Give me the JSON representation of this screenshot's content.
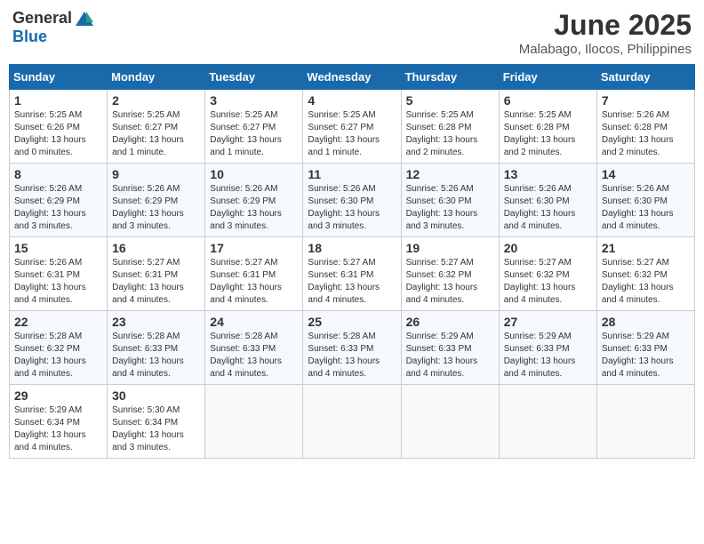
{
  "header": {
    "logo_general": "General",
    "logo_blue": "Blue",
    "month_title": "June 2025",
    "location": "Malabago, Ilocos, Philippines"
  },
  "weekdays": [
    "Sunday",
    "Monday",
    "Tuesday",
    "Wednesday",
    "Thursday",
    "Friday",
    "Saturday"
  ],
  "weeks": [
    [
      {
        "day": "1",
        "info": "Sunrise: 5:25 AM\nSunset: 6:26 PM\nDaylight: 13 hours\nand 0 minutes."
      },
      {
        "day": "2",
        "info": "Sunrise: 5:25 AM\nSunset: 6:27 PM\nDaylight: 13 hours\nand 1 minute."
      },
      {
        "day": "3",
        "info": "Sunrise: 5:25 AM\nSunset: 6:27 PM\nDaylight: 13 hours\nand 1 minute."
      },
      {
        "day": "4",
        "info": "Sunrise: 5:25 AM\nSunset: 6:27 PM\nDaylight: 13 hours\nand 1 minute."
      },
      {
        "day": "5",
        "info": "Sunrise: 5:25 AM\nSunset: 6:28 PM\nDaylight: 13 hours\nand 2 minutes."
      },
      {
        "day": "6",
        "info": "Sunrise: 5:25 AM\nSunset: 6:28 PM\nDaylight: 13 hours\nand 2 minutes."
      },
      {
        "day": "7",
        "info": "Sunrise: 5:26 AM\nSunset: 6:28 PM\nDaylight: 13 hours\nand 2 minutes."
      }
    ],
    [
      {
        "day": "8",
        "info": "Sunrise: 5:26 AM\nSunset: 6:29 PM\nDaylight: 13 hours\nand 3 minutes."
      },
      {
        "day": "9",
        "info": "Sunrise: 5:26 AM\nSunset: 6:29 PM\nDaylight: 13 hours\nand 3 minutes."
      },
      {
        "day": "10",
        "info": "Sunrise: 5:26 AM\nSunset: 6:29 PM\nDaylight: 13 hours\nand 3 minutes."
      },
      {
        "day": "11",
        "info": "Sunrise: 5:26 AM\nSunset: 6:30 PM\nDaylight: 13 hours\nand 3 minutes."
      },
      {
        "day": "12",
        "info": "Sunrise: 5:26 AM\nSunset: 6:30 PM\nDaylight: 13 hours\nand 3 minutes."
      },
      {
        "day": "13",
        "info": "Sunrise: 5:26 AM\nSunset: 6:30 PM\nDaylight: 13 hours\nand 4 minutes."
      },
      {
        "day": "14",
        "info": "Sunrise: 5:26 AM\nSunset: 6:30 PM\nDaylight: 13 hours\nand 4 minutes."
      }
    ],
    [
      {
        "day": "15",
        "info": "Sunrise: 5:26 AM\nSunset: 6:31 PM\nDaylight: 13 hours\nand 4 minutes."
      },
      {
        "day": "16",
        "info": "Sunrise: 5:27 AM\nSunset: 6:31 PM\nDaylight: 13 hours\nand 4 minutes."
      },
      {
        "day": "17",
        "info": "Sunrise: 5:27 AM\nSunset: 6:31 PM\nDaylight: 13 hours\nand 4 minutes."
      },
      {
        "day": "18",
        "info": "Sunrise: 5:27 AM\nSunset: 6:31 PM\nDaylight: 13 hours\nand 4 minutes."
      },
      {
        "day": "19",
        "info": "Sunrise: 5:27 AM\nSunset: 6:32 PM\nDaylight: 13 hours\nand 4 minutes."
      },
      {
        "day": "20",
        "info": "Sunrise: 5:27 AM\nSunset: 6:32 PM\nDaylight: 13 hours\nand 4 minutes."
      },
      {
        "day": "21",
        "info": "Sunrise: 5:27 AM\nSunset: 6:32 PM\nDaylight: 13 hours\nand 4 minutes."
      }
    ],
    [
      {
        "day": "22",
        "info": "Sunrise: 5:28 AM\nSunset: 6:32 PM\nDaylight: 13 hours\nand 4 minutes."
      },
      {
        "day": "23",
        "info": "Sunrise: 5:28 AM\nSunset: 6:33 PM\nDaylight: 13 hours\nand 4 minutes."
      },
      {
        "day": "24",
        "info": "Sunrise: 5:28 AM\nSunset: 6:33 PM\nDaylight: 13 hours\nand 4 minutes."
      },
      {
        "day": "25",
        "info": "Sunrise: 5:28 AM\nSunset: 6:33 PM\nDaylight: 13 hours\nand 4 minutes."
      },
      {
        "day": "26",
        "info": "Sunrise: 5:29 AM\nSunset: 6:33 PM\nDaylight: 13 hours\nand 4 minutes."
      },
      {
        "day": "27",
        "info": "Sunrise: 5:29 AM\nSunset: 6:33 PM\nDaylight: 13 hours\nand 4 minutes."
      },
      {
        "day": "28",
        "info": "Sunrise: 5:29 AM\nSunset: 6:33 PM\nDaylight: 13 hours\nand 4 minutes."
      }
    ],
    [
      {
        "day": "29",
        "info": "Sunrise: 5:29 AM\nSunset: 6:34 PM\nDaylight: 13 hours\nand 4 minutes."
      },
      {
        "day": "30",
        "info": "Sunrise: 5:30 AM\nSunset: 6:34 PM\nDaylight: 13 hours\nand 3 minutes."
      },
      {
        "day": "",
        "info": ""
      },
      {
        "day": "",
        "info": ""
      },
      {
        "day": "",
        "info": ""
      },
      {
        "day": "",
        "info": ""
      },
      {
        "day": "",
        "info": ""
      }
    ]
  ]
}
